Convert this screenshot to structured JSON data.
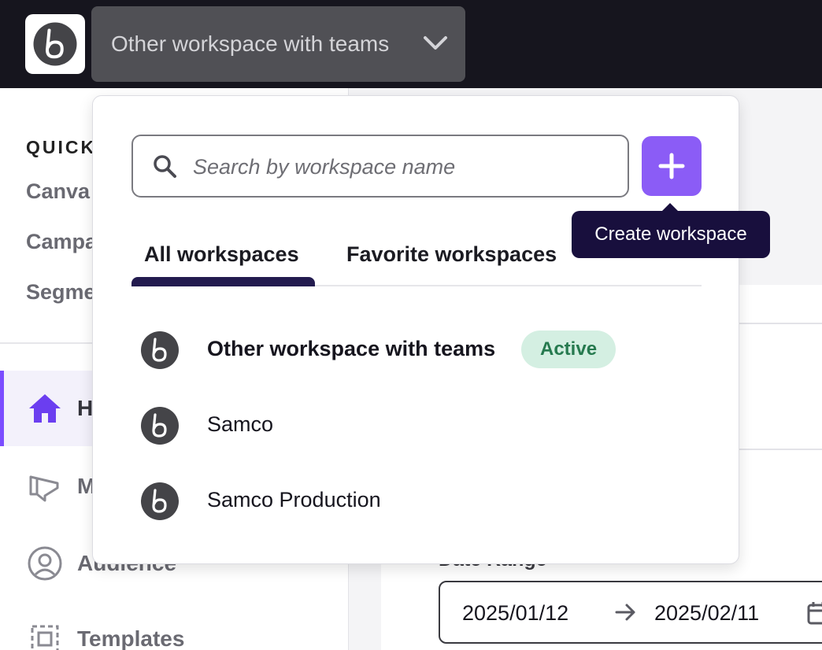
{
  "header": {
    "workspace_switcher_label": "Other workspace with teams"
  },
  "sidebar": {
    "quick_title": "QUICK",
    "quick_items": [
      "Canva",
      "Campa",
      "Segme"
    ],
    "nav_items": [
      {
        "label": "H",
        "icon": "home-icon",
        "active": true
      },
      {
        "label": "M",
        "icon": "megaphone-icon",
        "active": false
      },
      {
        "label": "Audience",
        "icon": "audience-icon",
        "active": false
      },
      {
        "label": "Templates",
        "icon": "templates-icon",
        "active": false
      }
    ]
  },
  "main": {
    "date_range_label": "Date Range",
    "start_date": "2025/01/12",
    "end_date": "2025/02/11"
  },
  "popover": {
    "search_placeholder": "Search by workspace name",
    "create_tooltip": "Create workspace",
    "tabs": [
      {
        "label": "All workspaces",
        "active": true
      },
      {
        "label": "Favorite workspaces",
        "active": false
      }
    ],
    "workspaces": [
      {
        "name": "Other workspace with teams",
        "badge": "Active",
        "current": true
      },
      {
        "name": "Samco",
        "badge": null,
        "current": false
      },
      {
        "name": "Samco Production",
        "badge": null,
        "current": false
      }
    ]
  },
  "colors": {
    "topbar": "#16151e",
    "accent": "#8b5cf6",
    "tooltip": "#180f3d",
    "active_badge_bg": "#d4efe2",
    "active_badge_text": "#267a4f"
  }
}
